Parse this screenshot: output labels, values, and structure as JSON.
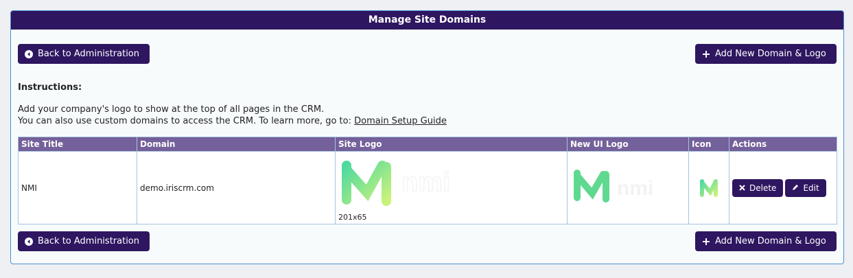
{
  "header": {
    "title": "Manage Site Domains"
  },
  "toolbar": {
    "back_label": "Back to Administration",
    "add_label": "Add New Domain & Logo"
  },
  "instructions": {
    "title": "Instructions:",
    "line1": "Add your company's logo to show at the top of all pages in the CRM.",
    "line2_prefix": "You can also use custom domains to access the CRM. To learn more, go to: ",
    "link_label": "Domain Setup Guide"
  },
  "table": {
    "columns": [
      "Site Title",
      "Domain",
      "Site Logo",
      "New UI Logo",
      "Icon",
      "Actions"
    ],
    "rows": [
      {
        "site_title": "NMI",
        "domain": "demo.iriscrm.com",
        "logo_size": "201x65",
        "logo_text": "nmi",
        "delete_label": "Delete",
        "edit_label": "Edit"
      }
    ]
  },
  "colors": {
    "primary": "#2e1660",
    "table_header": "#74609a",
    "logo_green": "#5fd98f"
  },
  "icons": {
    "back": "circle-left-icon",
    "add": "plus-icon",
    "delete": "x-icon",
    "edit": "pencil-icon"
  }
}
